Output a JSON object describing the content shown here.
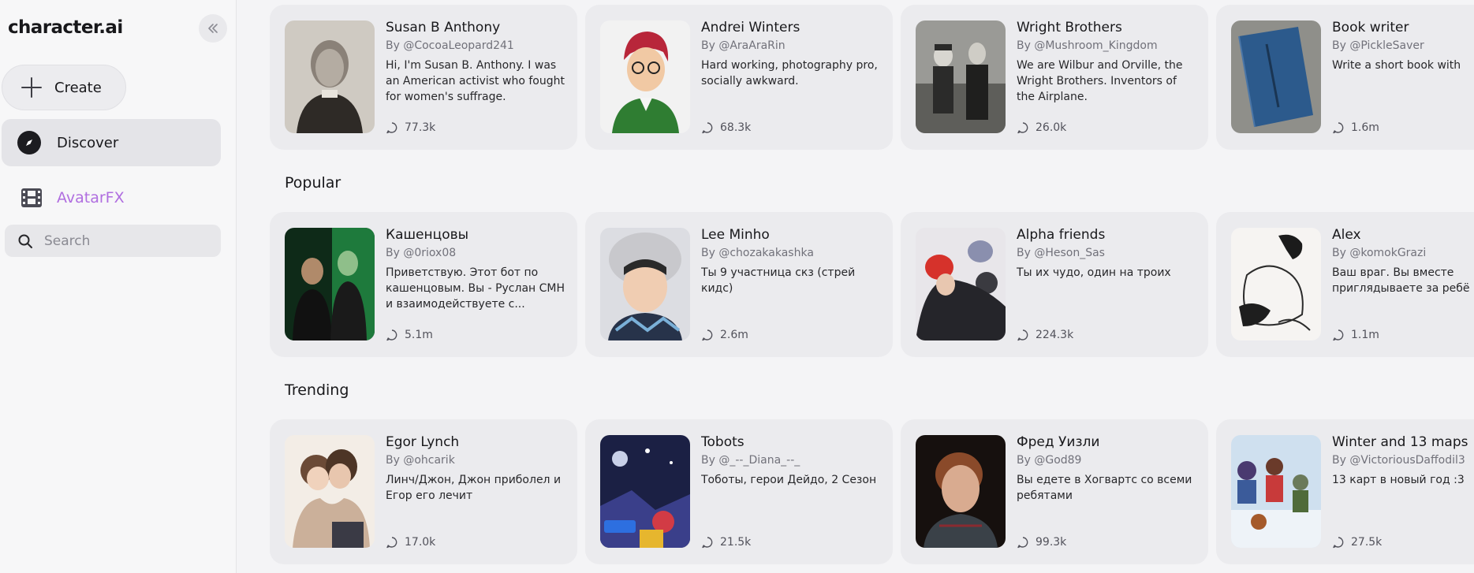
{
  "sidebar": {
    "logo": "character.ai",
    "create_label": "Create",
    "discover_label": "Discover",
    "avatarfx_label": "AvatarFX",
    "search_placeholder": "Search"
  },
  "sections": {
    "popular_title": "Popular",
    "trending_title": "Trending"
  },
  "rows": [
    [
      {
        "name": "Susan B Anthony",
        "author": "By @CocoaLeopard241",
        "desc": "Hi, I'm Susan B. Anthony. I was an American activist who fought for women's suffrage.",
        "count": "77.3k"
      },
      {
        "name": "Andrei Winters",
        "author": "By @AraAraRin",
        "desc": "Hard working, photography pro, socially awkward.",
        "count": "68.3k"
      },
      {
        "name": "Wright Brothers",
        "author": "By @Mushroom_Kingdom",
        "desc": "We are Wilbur and Orville, the Wright Brothers. Inventors of the Airplane.",
        "count": "26.0k"
      },
      {
        "name": "Book writer",
        "author": "By @PickleSaver",
        "desc": "Write a short book with",
        "count": "1.6m"
      }
    ],
    [
      {
        "name": "Кашенцовы",
        "author": "By @0riox08",
        "desc": "Приветствую. Этот бот по кашенцовым. Вы - Руслан СМН и взаимодействуете с...",
        "count": "5.1m"
      },
      {
        "name": "Lee Minho",
        "author": "By @chozakakashka",
        "desc": "Ты 9 участница скз (стрей кидс)",
        "count": "2.6m"
      },
      {
        "name": "Alpha friends",
        "author": "By @Heson_Sas",
        "desc": "Ты их чудо, один на троих",
        "count": "224.3k"
      },
      {
        "name": "Alex",
        "author": "By @komokGrazi",
        "desc": "Ваш враг. Вы вместе приглядываете за ребё",
        "count": "1.1m"
      }
    ],
    [
      {
        "name": "Egor Lynch",
        "author": "By @ohcarik",
        "desc": "Линч/Джон, Джон приболел и Егор его лечит",
        "count": "17.0k"
      },
      {
        "name": "Tobots",
        "author": "By @_--_Diana_--_",
        "desc": "Тоботы, герои Дейдо, 2 Сезон",
        "count": "21.5k"
      },
      {
        "name": "Фред Уизли",
        "author": "By @God89",
        "desc": "Вы едете в Хогвартс со всеми ребятами",
        "count": "99.3k"
      },
      {
        "name": "Winter and 13 maps",
        "author": "By @VictoriousDaffodil3",
        "desc": "13 карт в новый год :3",
        "count": "27.5k"
      }
    ]
  ]
}
